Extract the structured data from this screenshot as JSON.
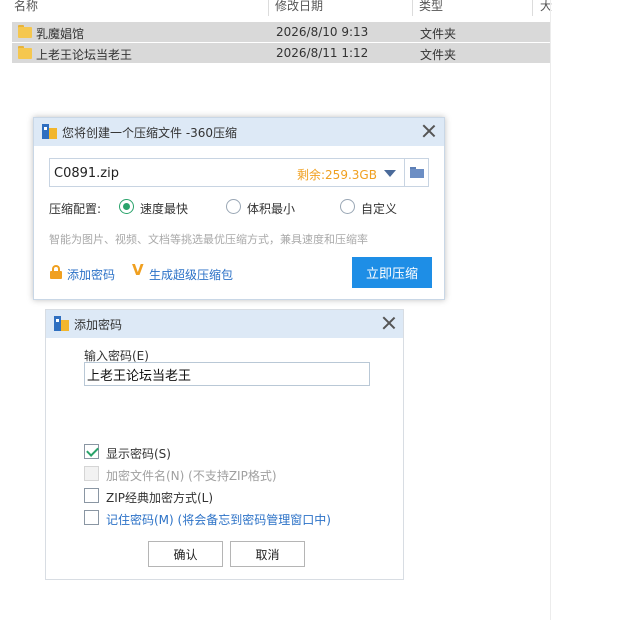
{
  "explorer": {
    "columns": {
      "name": "名称",
      "modified": "修改日期",
      "type": "类型",
      "size": "大"
    },
    "rows": [
      {
        "name": "乳魔娼馆",
        "modified": "2026/8/10 9:13",
        "type": "文件夹"
      },
      {
        "name": "上老王论坛当老王",
        "modified": "2026/8/11 1:12",
        "type": "文件夹"
      }
    ]
  },
  "compress_dialog": {
    "title": "您将创建一个压缩文件 -360压缩",
    "filename": "C0891.zip",
    "free_space": "剩余:259.3GB",
    "config_label": "压缩配置:",
    "options": [
      "速度最快",
      "体积最小",
      "自定义"
    ],
    "selected_option": 0,
    "hint": "智能为图片、视频、文档等挑选最优压缩方式，兼具速度和压缩率",
    "add_password": "添加密码",
    "super_compress": "生成超级压缩包",
    "compress_button": "立即压缩",
    "accent_color": "#1e8ee6",
    "warning_color": "#f0a020"
  },
  "password_dialog": {
    "title": "添加密码",
    "input_label": "输入密码(E)",
    "password_value": "上老王论坛当老王",
    "show_password": "显示密码(S)",
    "encrypt_filenames": "加密文件名(N) (不支持ZIP格式)",
    "zip_classic": "ZIP经典加密方式(L)",
    "remember_password": "记住密码(M) (将会备忘到密码管理窗口中)",
    "show_password_checked": true,
    "ok_button": "确认",
    "cancel_button": "取消"
  }
}
